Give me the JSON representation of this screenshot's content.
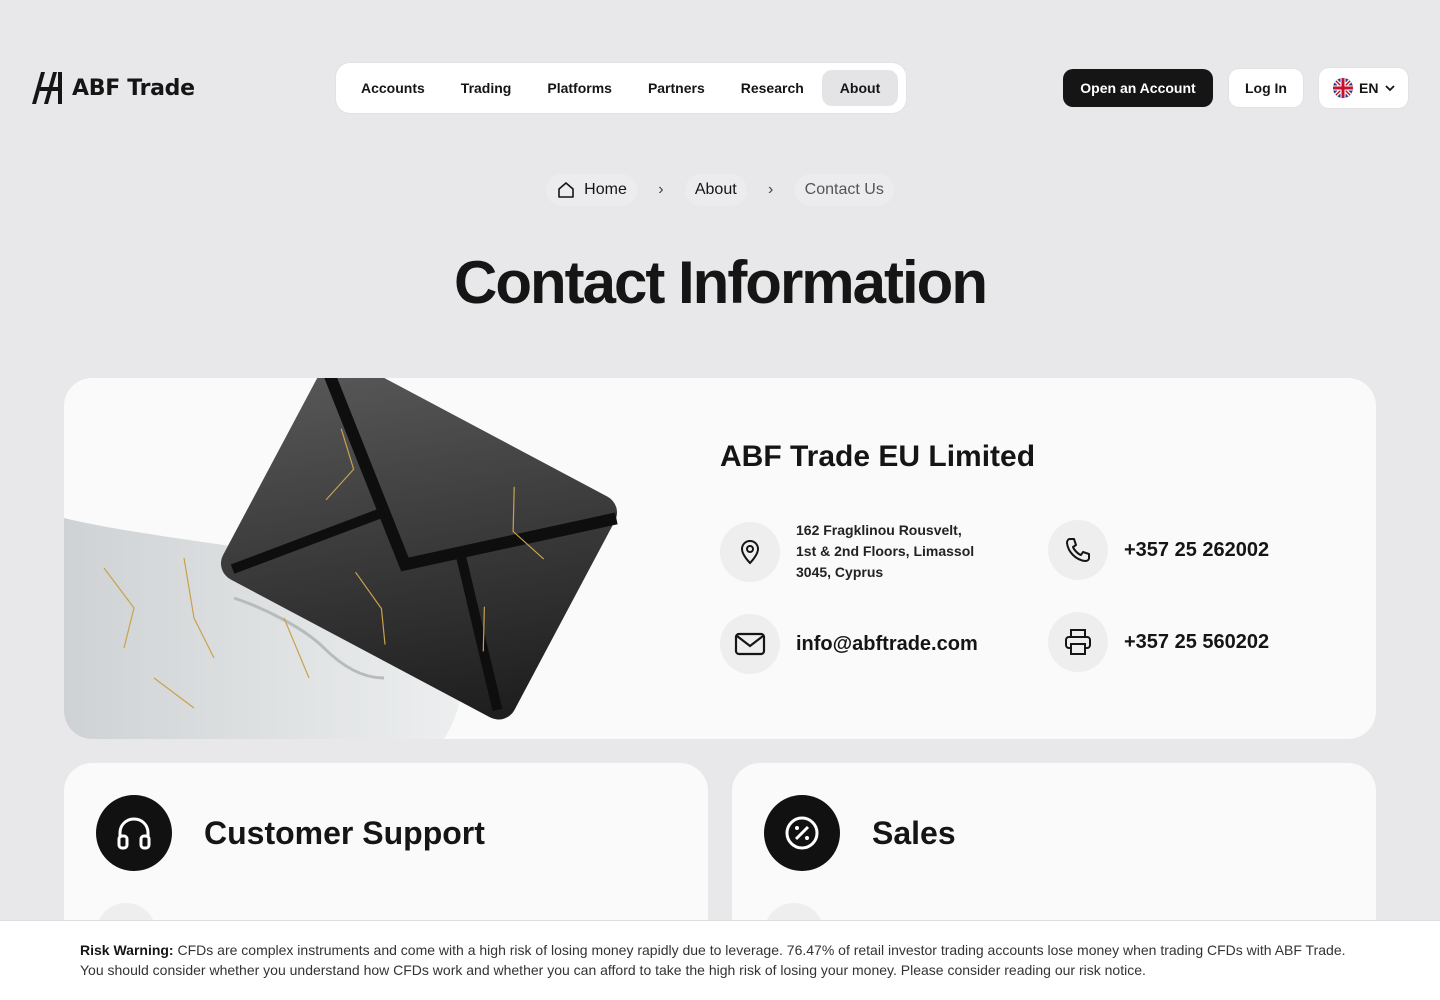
{
  "brand": {
    "name": "ABF Trade"
  },
  "nav": {
    "items": [
      {
        "label": "Accounts"
      },
      {
        "label": "Trading"
      },
      {
        "label": "Platforms"
      },
      {
        "label": "Partners"
      },
      {
        "label": "Research"
      },
      {
        "label": "About"
      }
    ],
    "active": "About"
  },
  "header": {
    "open_account": "Open an Account",
    "login": "Log In",
    "language": "EN"
  },
  "breadcrumb": [
    {
      "label": "Home"
    },
    {
      "label": "About"
    },
    {
      "label": "Contact Us"
    }
  ],
  "page": {
    "title": "Contact Information"
  },
  "company": {
    "name": "ABF Trade EU Limited",
    "address_line1": "162 Fragklinou Rousvelt,",
    "address_line2": "1st & 2nd Floors, Limassol",
    "address_line3": "3045, Cyprus",
    "phone": "+357 25 262002",
    "email": "info@abftrade.com",
    "fax": "+357 25 560202"
  },
  "cards": [
    {
      "title": "Customer Support",
      "icon": "headphones-icon"
    },
    {
      "title": "Sales",
      "icon": "percent-badge-icon"
    }
  ],
  "risk": {
    "label": "Risk Warning:",
    "text": "CFDs are complex instruments and come with a high risk of losing money rapidly due to leverage. 76.47% of retail investor trading accounts lose money when trading CFDs with ABF Trade. You should consider whether you understand how CFDs work and whether you can afford to take the high risk of losing your money. Please consider reading our risk notice."
  }
}
